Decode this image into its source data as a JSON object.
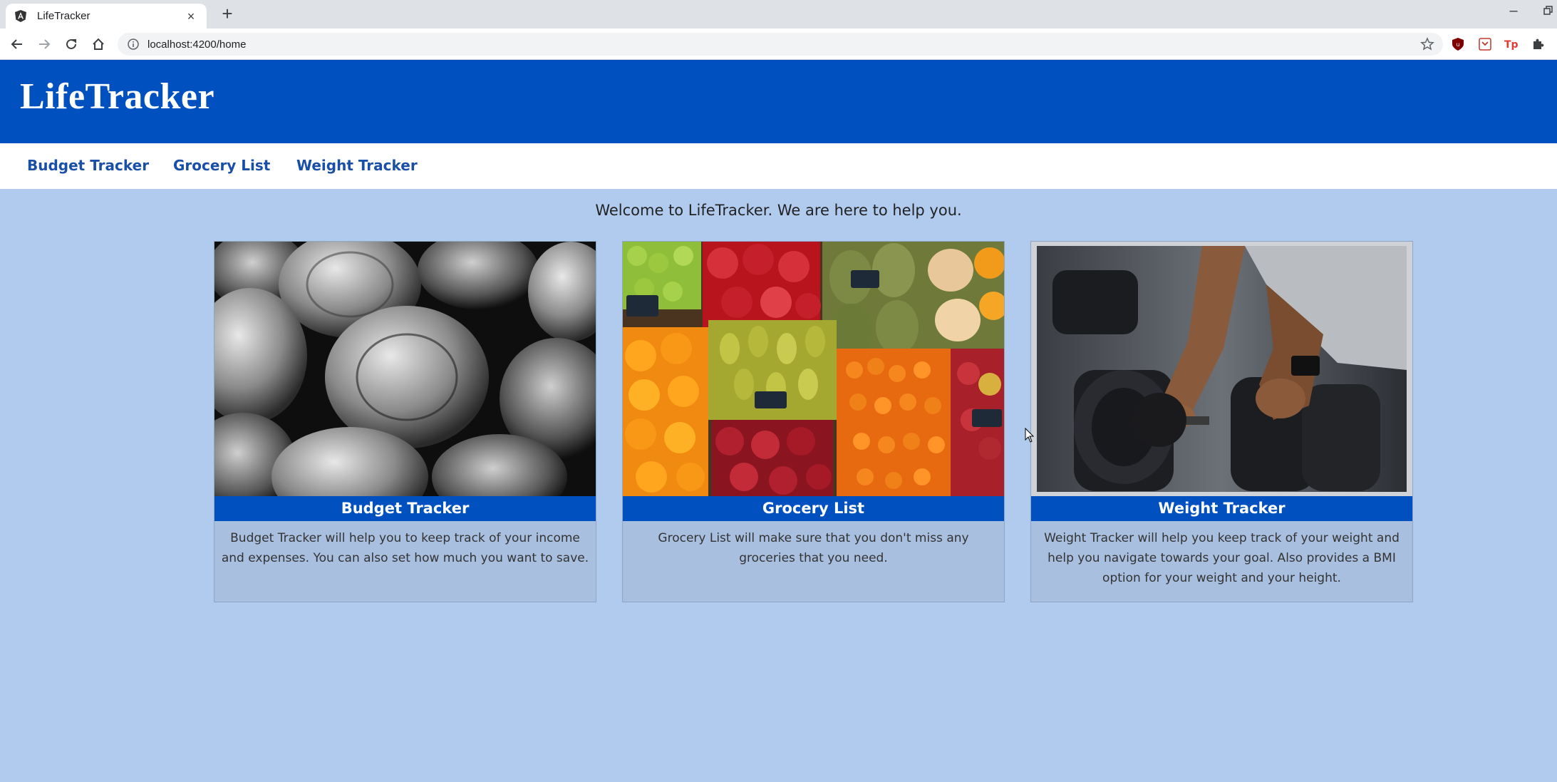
{
  "browser": {
    "tab_title": "LifeTracker",
    "tab_close": "×",
    "new_tab": "+",
    "url": "localhost:4200/home",
    "minimize": "–"
  },
  "app": {
    "brand": "LifeTracker",
    "header_color": "#0050c0",
    "nav": [
      {
        "label": "Budget Tracker"
      },
      {
        "label": "Grocery List"
      },
      {
        "label": "Weight Tracker"
      }
    ],
    "welcome": "Welcome to LifeTracker. We are here to help you.",
    "cards": [
      {
        "title": "Budget Tracker",
        "description": "Budget Tracker will help you to keep track of your income and expenses. You can also set how much you want to save.",
        "image": "coins-photo"
      },
      {
        "title": "Grocery List",
        "description": "Grocery List will make sure that you don't miss any groceries that you need.",
        "image": "fruit-market-photo"
      },
      {
        "title": "Weight Tracker",
        "description": "Weight Tracker will help you keep track of your weight and help you navigate towards your goal. Also provides a BMI option for your weight and your height.",
        "image": "dumbbell-gym-photo"
      }
    ]
  }
}
